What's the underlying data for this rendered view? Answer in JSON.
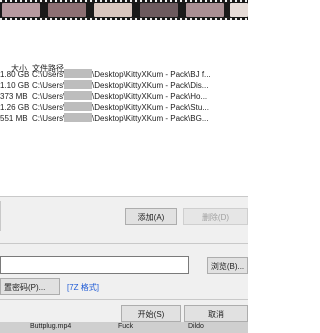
{
  "columns": {
    "size": "大小",
    "path": "文件路径"
  },
  "files": [
    {
      "size": "1.80 GB",
      "path_prefix": "C:\\Users\\",
      "path_suffix": "\\Desktop\\KittyXKum - Pack\\BJ f..."
    },
    {
      "size": "1.10 GB",
      "path_prefix": "C:\\Users\\",
      "path_suffix": "\\Desktop\\KittyXKum - Pack\\Dis..."
    },
    {
      "size": "373 MB",
      "path_prefix": "C:\\Users\\",
      "path_suffix": "\\Desktop\\KittyXKum - Pack\\Ho..."
    },
    {
      "size": "1.26 GB",
      "path_prefix": "C:\\Users\\",
      "path_suffix": "\\Desktop\\KittyXKum - Pack\\Stu..."
    },
    {
      "size": "551 MB",
      "path_prefix": "C:\\Users\\",
      "path_suffix": "\\Desktop\\KittyXKum - Pack\\BG..."
    }
  ],
  "buttons": {
    "add": "添加(A)",
    "delete": "删除(D)",
    "browse": "浏览(B)...",
    "password": "置密码(P)...",
    "start": "开始(S)",
    "cancel": "取消"
  },
  "format_label": "[7Z 格式]",
  "taskbar_labels": [
    "Buttplug.mp4",
    "Fuck",
    "Dildo"
  ],
  "colors": {
    "link": "#1f5bd6",
    "dialog_bg": "#f0f0f0",
    "button_bg": "#e1e1e1"
  }
}
